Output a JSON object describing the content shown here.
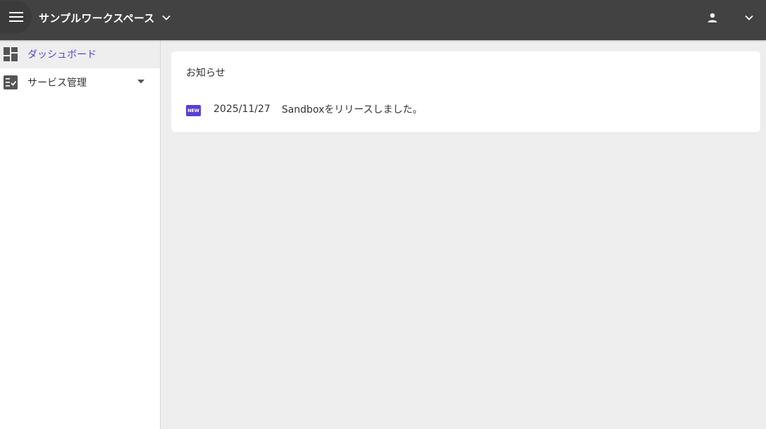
{
  "header": {
    "workspace_title": "サンプルワークスペース",
    "icons": {
      "menu": "hamburger-menu-icon",
      "workspace_dropdown": "chevron-down-icon",
      "user": "person-icon",
      "user_dropdown": "chevron-down-icon"
    },
    "background_color": "#424242"
  },
  "sidebar": {
    "items": [
      {
        "label": "ダッシュボード",
        "icon": "dashboard-icon",
        "active": true
      },
      {
        "label": "サービス管理",
        "icon": "checklist-icon",
        "active": false,
        "expandable": true
      }
    ],
    "accent_color": "#5b3fd4"
  },
  "main": {
    "notice_card": {
      "title": "お知らせ",
      "items": [
        {
          "badge": "NEW",
          "date": "2025/11/27",
          "text": "Sandboxをリリースしました。"
        }
      ]
    },
    "background_color": "#eeeeee"
  }
}
